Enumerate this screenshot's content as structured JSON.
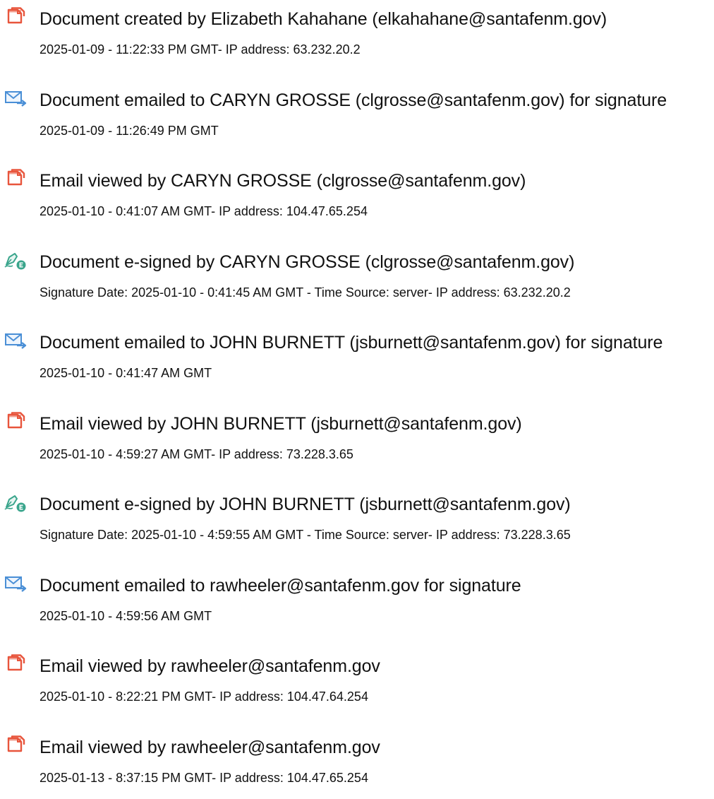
{
  "colors": {
    "doc_icon": "#e8553c",
    "email_icon": "#4a8fd6",
    "sign_icon": "#3aa58c",
    "text": "#111111"
  },
  "entries": [
    {
      "icon": "document-icon",
      "title": "Document created by Elizabeth Kahahane (elkahahane@santafenm.gov)",
      "detail": "2025-01-09 - 11:22:33 PM GMT- IP address: 63.232.20.2"
    },
    {
      "icon": "email-sent-icon",
      "title": "Document emailed to CARYN GROSSE (clgrosse@santafenm.gov) for signature",
      "detail": "2025-01-09 - 11:26:49 PM GMT"
    },
    {
      "icon": "document-icon",
      "title": "Email viewed by CARYN GROSSE (clgrosse@santafenm.gov)",
      "detail": "2025-01-10 - 0:41:07 AM GMT- IP address: 104.47.65.254"
    },
    {
      "icon": "e-sign-icon",
      "title": "Document e-signed by CARYN GROSSE (clgrosse@santafenm.gov)",
      "detail": "Signature Date: 2025-01-10 - 0:41:45 AM GMT - Time Source: server- IP address: 63.232.20.2"
    },
    {
      "icon": "email-sent-icon",
      "title": "Document emailed to JOHN BURNETT (jsburnett@santafenm.gov) for signature",
      "detail": "2025-01-10 - 0:41:47 AM GMT"
    },
    {
      "icon": "document-icon",
      "title": "Email viewed by JOHN BURNETT (jsburnett@santafenm.gov)",
      "detail": "2025-01-10 - 4:59:27 AM GMT- IP address: 73.228.3.65"
    },
    {
      "icon": "e-sign-icon",
      "title": "Document e-signed by JOHN BURNETT (jsburnett@santafenm.gov)",
      "detail": "Signature Date: 2025-01-10 - 4:59:55 AM GMT - Time Source: server- IP address: 73.228.3.65"
    },
    {
      "icon": "email-sent-icon",
      "title": "Document emailed to rawheeler@santafenm.gov for signature",
      "detail": "2025-01-10 - 4:59:56 AM GMT"
    },
    {
      "icon": "document-icon",
      "title": "Email viewed by rawheeler@santafenm.gov",
      "detail": "2025-01-10 - 8:22:21 PM GMT- IP address: 104.47.64.254"
    },
    {
      "icon": "document-icon",
      "title": "Email viewed by rawheeler@santafenm.gov",
      "detail": "2025-01-13 - 8:37:15 PM GMT- IP address: 104.47.65.254"
    }
  ]
}
